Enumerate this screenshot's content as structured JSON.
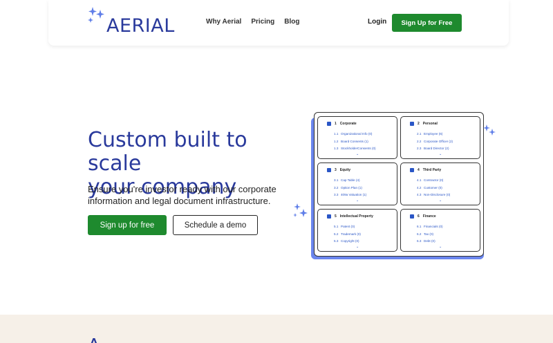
{
  "header": {
    "logo_text": "AERIAL",
    "nav": [
      "Why Aerial",
      "Pricing",
      "Blog"
    ],
    "login_label": "Login",
    "signup_label": "Sign Up for Free"
  },
  "hero": {
    "title_line1": "Custom built to scale",
    "title_line2": "your company",
    "subtitle_line1": "Ensure you're investor ready with our corporate",
    "subtitle_line2": "information and legal document infrastructure.",
    "primary_cta": "Sign up for free",
    "secondary_cta": "Schedule a demo"
  },
  "diagram": {
    "cells": [
      {
        "num": "1",
        "title": "Corporate",
        "items": [
          [
            "1.1",
            "Organizational Info (0)"
          ],
          [
            "1.2",
            "Board Consents (1)"
          ],
          [
            "1.3",
            "StockholderConsents (0)"
          ]
        ]
      },
      {
        "num": "2",
        "title": "Personal",
        "items": [
          [
            "2.1",
            "Employee (6)"
          ],
          [
            "2.2",
            "Corporate Officer (2)"
          ],
          [
            "2.3",
            "Board Director (2)"
          ]
        ]
      },
      {
        "num": "3",
        "title": "Equity",
        "items": [
          [
            "3.1",
            "Cap Table (4)"
          ],
          [
            "3.2",
            "Option Plan (1)"
          ],
          [
            "3.3",
            "409a Valuation (1)"
          ]
        ]
      },
      {
        "num": "4",
        "title": "Third Party",
        "items": [
          [
            "4.1",
            "Contractor (0)"
          ],
          [
            "4.2",
            "Customer (0)"
          ],
          [
            "4.3",
            "Non-Disclosure (0)"
          ]
        ]
      },
      {
        "num": "5",
        "title": "Intellectual Property",
        "items": [
          [
            "5.1",
            "Patent (0)"
          ],
          [
            "5.2",
            "Trademark (0)"
          ],
          [
            "5.3",
            "Copyright (0)"
          ]
        ]
      },
      {
        "num": "6",
        "title": "Finance",
        "items": [
          [
            "6.1",
            "Financials (0)"
          ],
          [
            "6.2",
            "Tax (0)"
          ],
          [
            "6.3",
            "Debt (0)"
          ]
        ]
      }
    ]
  },
  "band": {
    "text": "A "
  },
  "colors": {
    "brand_blue": "#2a3a9c",
    "accent_green": "#1e8a2e",
    "link_blue": "#2a56c6",
    "shadow_blue": "#6b86ee",
    "band_beige": "#f6f0e8"
  }
}
